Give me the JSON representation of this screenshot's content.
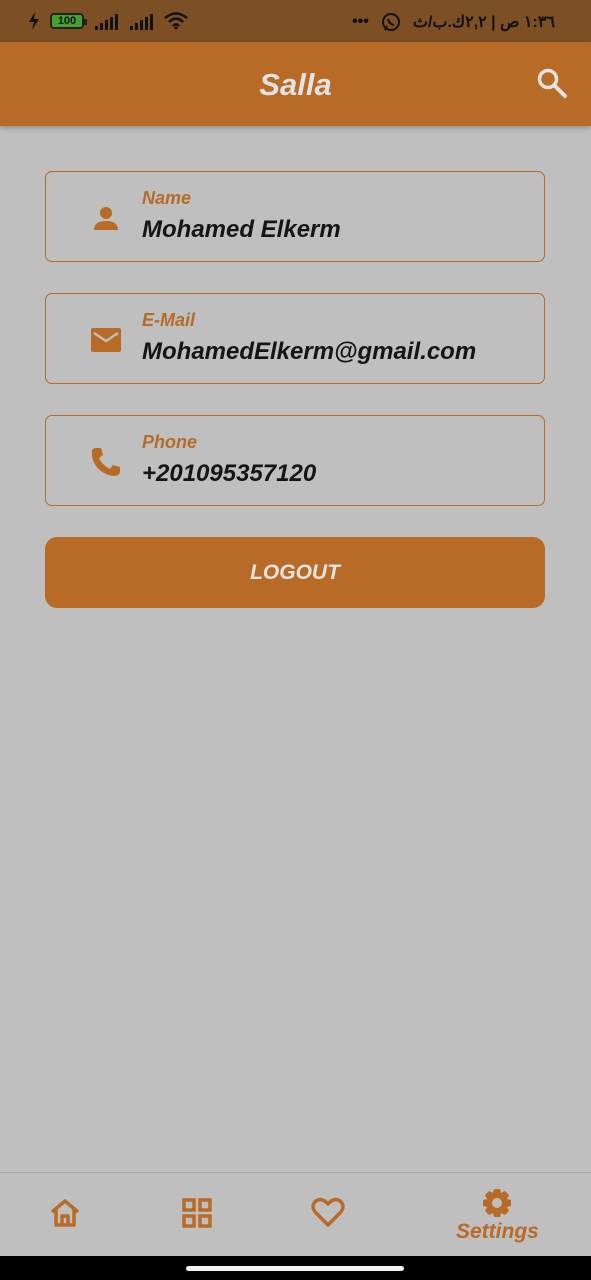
{
  "status_bar": {
    "battery": "100",
    "right_text": "١:٣٦ ص | ٢,٢ك.ب/ث",
    "dots": "•••"
  },
  "app_bar": {
    "title": "Salla"
  },
  "profile": {
    "fields": [
      {
        "label": "Name",
        "value": "Mohamed Elkerm",
        "icon": "person-icon"
      },
      {
        "label": "E-Mail",
        "value": "MohamedElkerm@gmail.com",
        "icon": "email-icon"
      },
      {
        "label": "Phone",
        "value": "+201095357120",
        "icon": "phone-icon"
      }
    ],
    "logout_label": "LOGOUT"
  },
  "bottom_nav": {
    "items": [
      {
        "icon": "home-icon"
      },
      {
        "icon": "categories-icon"
      },
      {
        "icon": "favorite-icon"
      },
      {
        "icon": "settings-icon",
        "label": "Settings"
      }
    ]
  },
  "colors": {
    "primary": "#b86a27",
    "background": "#bfbfbf",
    "app_title": "#e3e3e3",
    "text": "#151515"
  }
}
